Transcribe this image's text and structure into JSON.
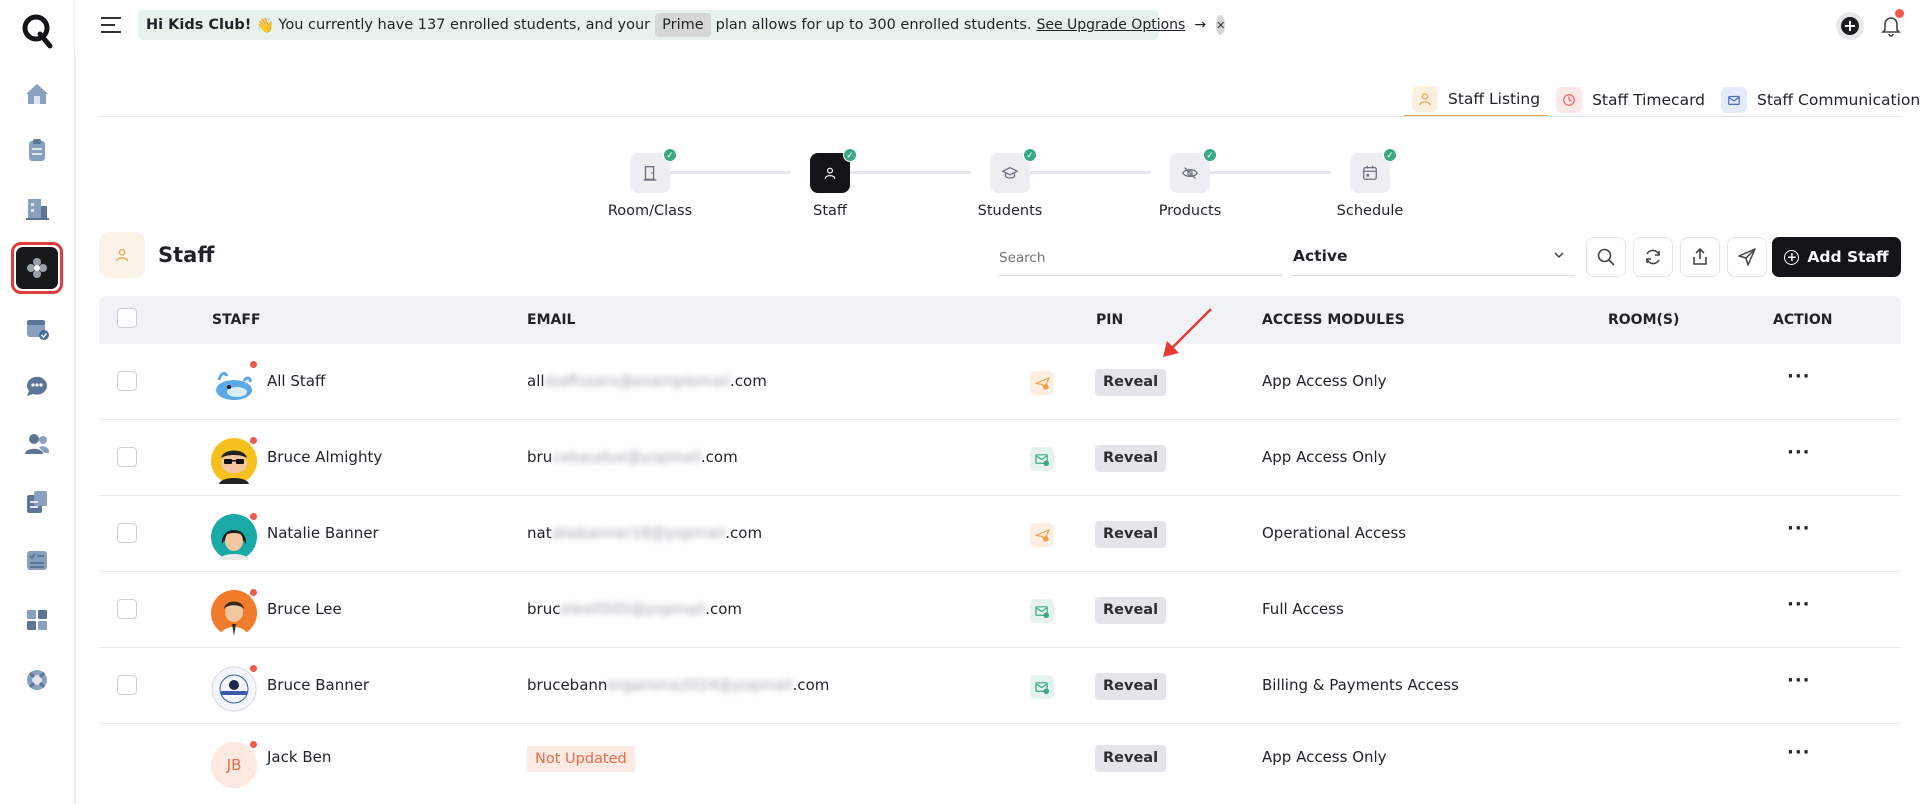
{
  "banner": {
    "greeting": "Hi Kids Club!",
    "emoji": "👋",
    "msg_part1": "You currently have 137 enrolled students, and your",
    "plan": "Prime",
    "msg_part2": "plan allows for up to 300 enrolled students.",
    "link": "See Upgrade Options",
    "arrow": "→",
    "close": "✕"
  },
  "tabs": [
    {
      "label": "Staff Listing",
      "icon": "user-icon",
      "color": "#fbefe0"
    },
    {
      "label": "Staff Timecard",
      "icon": "clock-icon",
      "color": "#fde7e7"
    },
    {
      "label": "Staff Communication",
      "icon": "mail-icon",
      "color": "#e4eaf8"
    }
  ],
  "stepper": [
    {
      "label": "Room/Class",
      "icon": "door-icon",
      "active": false,
      "done": true
    },
    {
      "label": "Staff",
      "icon": "user-icon",
      "active": true,
      "done": true
    },
    {
      "label": "Students",
      "icon": "graduation-cap-icon",
      "active": false,
      "done": true
    },
    {
      "label": "Products",
      "icon": "eye-off-icon",
      "active": false,
      "done": true
    },
    {
      "label": "Schedule",
      "icon": "calendar-icon",
      "active": false,
      "done": true
    }
  ],
  "page": {
    "title": "Staff",
    "search_placeholder": "Search",
    "status": "Active",
    "add_staff": "Add Staff"
  },
  "table": {
    "headers": {
      "staff": "STAFF",
      "email": "EMAIL",
      "pin": "PIN",
      "access": "ACCESS MODULES",
      "rooms": "ROOM(S)",
      "action": "ACTION"
    },
    "rows": [
      {
        "name": "All Staff",
        "email_start": "all",
        "email_blur": "staffusers@examplemail",
        "email_end": ".com",
        "invite": "sent",
        "pin": "Reveal",
        "access": "App Access Only",
        "action": "···"
      },
      {
        "name": "Bruce Almighty",
        "email_start": "bru",
        "email_blur": "cebaudue@yopmail",
        "email_end": ".com",
        "invite": "accepted",
        "pin": "Reveal",
        "access": "App Access Only",
        "action": "···"
      },
      {
        "name": "Natalie Banner",
        "email_start": "nat",
        "email_blur": "aliebanner18@yopmail",
        "email_end": ".com",
        "invite": "sent",
        "pin": "Reveal",
        "access": "Operational Access",
        "action": "···"
      },
      {
        "name": "Bruce Lee",
        "email_start": "bruc",
        "email_blur": "elee0505@yopmail",
        "email_end": ".com",
        "invite": "accepted",
        "pin": "Reveal",
        "access": "Full Access",
        "action": "···"
      },
      {
        "name": "Bruce Banner",
        "email_start": "brucebann",
        "email_blur": "ergamma2024@yopmail",
        "email_end": ".com",
        "invite": "accepted",
        "pin": "Reveal",
        "access": "Billing & Payments Access",
        "action": "···"
      },
      {
        "name": "Jack Ben",
        "initials": "JB",
        "email_status": "Not Updated",
        "pin": "Reveal",
        "access": "App Access Only",
        "action": "···"
      }
    ]
  },
  "colors": {
    "accent_orange": "#e8a44f",
    "dark": "#121417",
    "notification_red": "#f15a4a",
    "success_green": "#3aa981"
  }
}
